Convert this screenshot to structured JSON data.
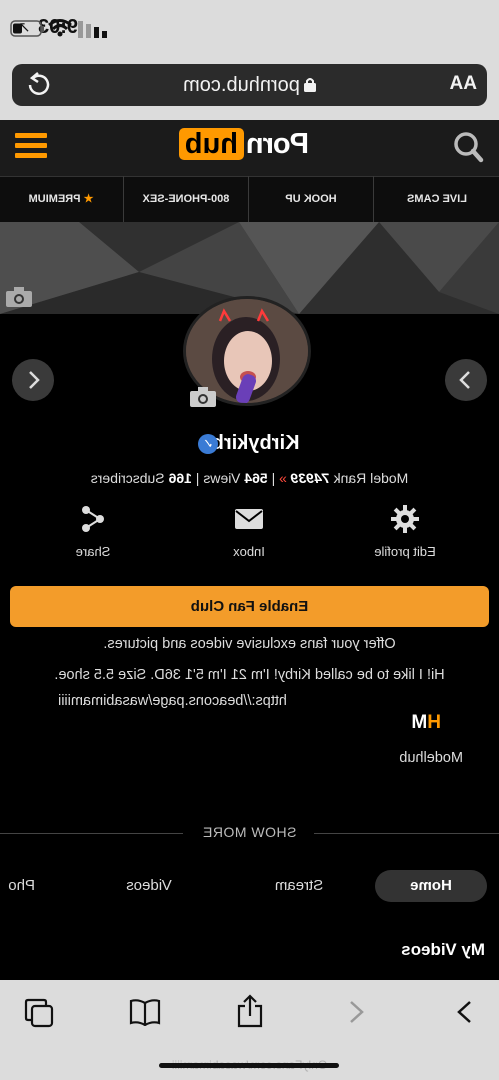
{
  "status": {
    "time": "9:03",
    "location_arrow": "↗"
  },
  "browser": {
    "url": "pornhub.com",
    "text_size_label": "AA"
  },
  "logo": {
    "part1": "Porn",
    "part2": "hub"
  },
  "nav": [
    "LIVE CAMS",
    "HOOK UP",
    "800-PHONE-SEX",
    "PREMIUM"
  ],
  "nav_premium_star": "★",
  "profile": {
    "name": "Kirbykirbo",
    "verified_mark": "✓",
    "rank_label": "Model Rank",
    "rank_value": "74939",
    "views_value": "564",
    "views_label": "Views",
    "subs_value": "166",
    "subs_label": "Subscribers"
  },
  "actions": {
    "edit": "Edit profile",
    "inbox": "Inbox",
    "share": "Share"
  },
  "fan_club_button": "Enable Fan Club",
  "bio": {
    "line1": "Offer your fans exclusive videos and pictures.",
    "line2": "Hi! I like to be called Kirby! I'm 21 I'm 5'1 36D. Size 5.5 shoe.",
    "line3": "https://beacons.page/wasabimamiiii"
  },
  "modelhub": {
    "h": "H",
    "m": "M",
    "label": "Modelhub"
  },
  "show_more": "SHOW MORE",
  "tabs": [
    "Home",
    "Stream",
    "Videos",
    "Pho"
  ],
  "section_title": "My Videos",
  "watermark": "OnlyFans.com/wasabimamiiii"
}
